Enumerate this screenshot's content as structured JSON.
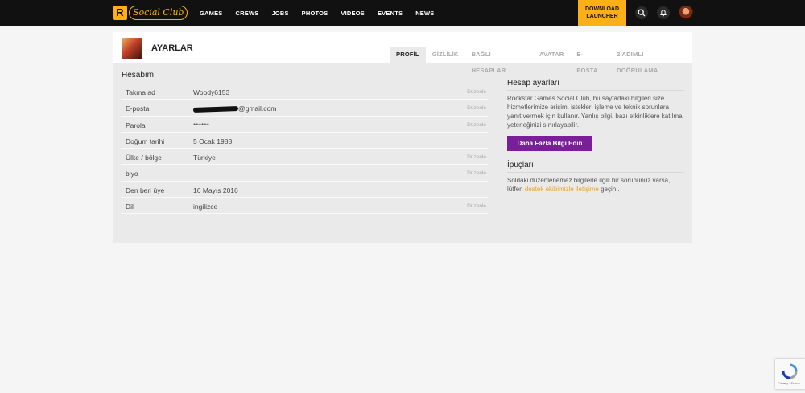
{
  "brand": {
    "r_letter": "R",
    "name": "Social Club"
  },
  "nav": [
    "GAMES",
    "CREWS",
    "JOBS",
    "PHOTOS",
    "VIDEOS",
    "EVENTS",
    "NEWS"
  ],
  "download": {
    "line1": "DOWNLOAD",
    "line2": "LAUNCHER"
  },
  "page_title": "AYARLAR",
  "tabs": [
    "PROFİL",
    "GİZLİLİK",
    "BAĞLI HESAPLAR",
    "AVATAR",
    "E-POSTA",
    "2 ADIMLI DOĞRULAMA"
  ],
  "account": {
    "title": "Hesabım",
    "edit_label": "Düzenle",
    "rows": [
      {
        "label": "Takma ad",
        "value": "Woody6153"
      },
      {
        "label": "E-posta",
        "value": "@gmail.com"
      },
      {
        "label": "Parola",
        "value": "******"
      },
      {
        "label": "Doğum tarihi",
        "value": "5 Ocak 1988"
      },
      {
        "label": "Ülke / bölge",
        "value": "Türkiye"
      },
      {
        "label": "biyo",
        "value": ""
      },
      {
        "label": "Den beri üye",
        "value": "16 Mayıs 2016"
      },
      {
        "label": "Dil",
        "value": "ingilizce"
      }
    ]
  },
  "sidebar": {
    "settings_title": "Hesap ayarları",
    "settings_text": "Rockstar Games Social Club, bu sayfadaki bilgileri size hizmetlerimize erişim, istekleri işleme ve teknik sorunlara yanıt vermek için kullanır. Yanlış bilgi, bazı etkinliklere katılma yeteneğinizi sınırlayabilir.",
    "more_button": "Daha Fazla Bilgi Edin",
    "tips_title": "İpuçları",
    "tips_text_before": "Soldaki düzenlenemez bilgilerle ilgili bir sorununuz varsa, lütfen",
    "tips_link": "destek ekibimizle iletişime",
    "tips_text_after": "geçin ."
  },
  "recaptcha": {
    "text": "Privacy - Terms"
  },
  "colors": {
    "accent": "#fcaf17",
    "button": "#7a1f99",
    "link": "#f3a21c"
  }
}
